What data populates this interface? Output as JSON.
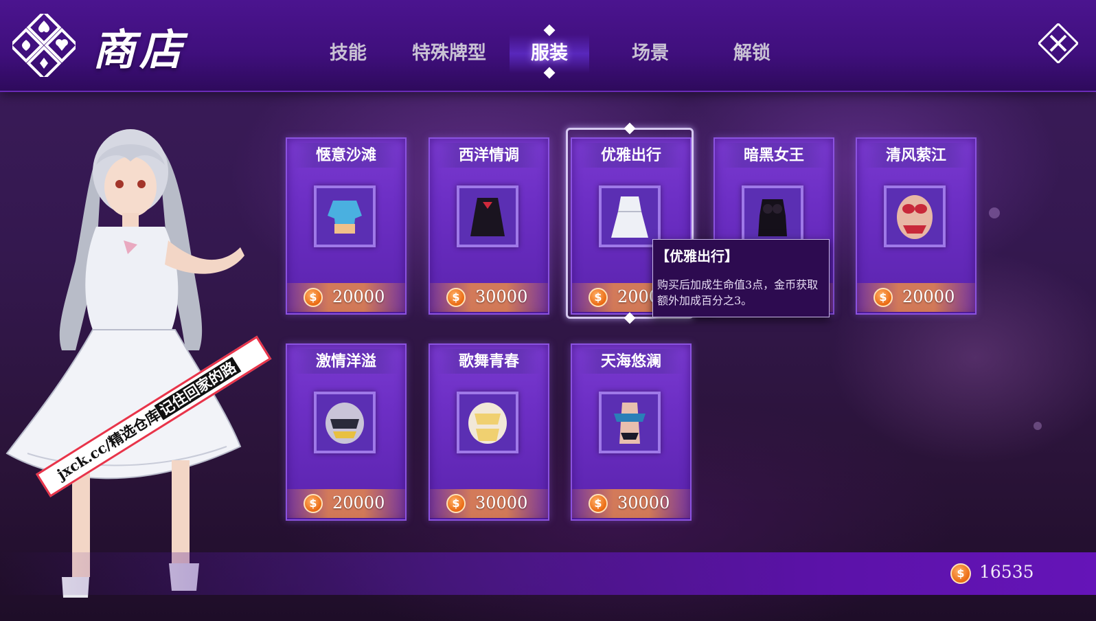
{
  "header": {
    "title": "商店",
    "tabs": [
      {
        "label": "技能",
        "active": false
      },
      {
        "label": "特殊牌型",
        "active": false
      },
      {
        "label": "服装",
        "active": true
      },
      {
        "label": "场景",
        "active": false
      },
      {
        "label": "解锁",
        "active": false
      }
    ],
    "close_icon": "close-x-icon"
  },
  "shop": {
    "items": [
      {
        "name": "惬意沙滩",
        "price": "20000",
        "icon": "blue-top-outfit-icon"
      },
      {
        "name": "西洋情调",
        "price": "30000",
        "icon": "black-maid-outfit-icon"
      },
      {
        "name": "优雅出行",
        "price": "2000",
        "icon": "white-dress-outfit-icon",
        "selected": true
      },
      {
        "name": "暗黑女王",
        "price": "",
        "icon": "black-lingerie-outfit-icon"
      },
      {
        "name": "清风萦江",
        "price": "20000",
        "icon": "red-bikini-outfit-icon"
      },
      {
        "name": "激情洋溢",
        "price": "20000",
        "icon": "sport-bra-outfit-icon"
      },
      {
        "name": "歌舞青春",
        "price": "30000",
        "icon": "yellow-outfit-icon"
      },
      {
        "name": "天海悠澜",
        "price": "30000",
        "icon": "blue-swimsuit-outfit-icon"
      }
    ],
    "currency_symbol": "$"
  },
  "tooltip": {
    "title": "【优雅出行】",
    "description": "购买后加成生命值3点，金币获取额外加成百分之3。"
  },
  "footer": {
    "balance": "16535"
  },
  "watermark": {
    "text_light": "jxck.cc/精选仓库",
    "text_dark": "记住回家的路"
  },
  "colors": {
    "accent_purple": "#6d2fc5",
    "coin_orange": "#ea6a12",
    "topbar": "#4b148f"
  }
}
